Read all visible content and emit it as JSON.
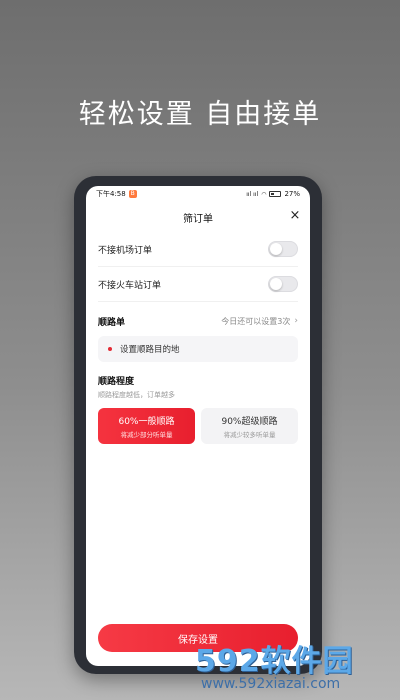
{
  "headline": "轻松设置 自由接单",
  "statusbar": {
    "time": "下午4:58",
    "notif_badge": "B",
    "signal": "ııl ııl",
    "battery_pct": "27%"
  },
  "dialog": {
    "title": "筛订单",
    "close_symbol": "×"
  },
  "toggles": [
    {
      "label": "不接机场订单",
      "on": false
    },
    {
      "label": "不接火车站订单",
      "on": false
    }
  ],
  "route": {
    "title": "顺路单",
    "link": "今日还可以设置3次",
    "destination_placeholder": "设置顺路目的地"
  },
  "degree": {
    "title": "顺路程度",
    "subtitle": "顺路程度越低，订单越多",
    "options": [
      {
        "title": "60%一般顺路",
        "sub": "将减少部分听单量",
        "active": true
      },
      {
        "title": "90%超级顺路",
        "sub": "将减少较多听单量",
        "active": false
      }
    ]
  },
  "save_label": "保存设置",
  "watermark": {
    "brand": "592软件园",
    "url": "www.592xiazai.com"
  },
  "colors": {
    "accent": "#e81f2e",
    "watermark_blue": "#5ca8e8"
  }
}
